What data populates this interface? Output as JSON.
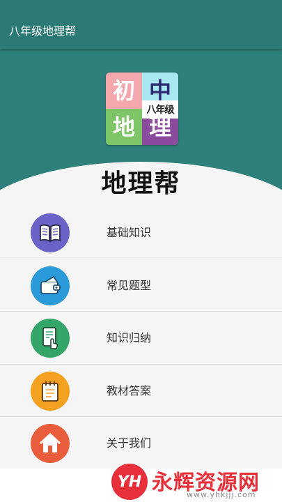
{
  "appbar": {
    "title": "八年级地理帮"
  },
  "logo": {
    "q1": "初",
    "q2": "中",
    "q3": "地",
    "q4": "理",
    "grade": "八年级",
    "colors": {
      "pink": "#f4a7ad",
      "cyan": "#a9e7f0",
      "green": "#7ec567",
      "purple": "#8a4a9e"
    }
  },
  "brand": "地理帮",
  "menu": {
    "items": [
      {
        "label": "基础知识",
        "icon": "book-icon",
        "color": "#6c63c9"
      },
      {
        "label": "常见题型",
        "icon": "wallet-icon",
        "color": "#2a9ad8"
      },
      {
        "label": "知识归纳",
        "icon": "tap-document-icon",
        "color": "#35a66a"
      },
      {
        "label": "教材答案",
        "icon": "notepad-icon",
        "color": "#f4a020"
      },
      {
        "label": "关于我们",
        "icon": "home-icon",
        "color": "#ea5d3c"
      }
    ]
  },
  "watermark": {
    "badge": "YH",
    "text": "永辉资源网",
    "url": "www.yhkjjj.com"
  },
  "theme": {
    "primary": "#2c7a76",
    "header": "#2f7f7a"
  }
}
